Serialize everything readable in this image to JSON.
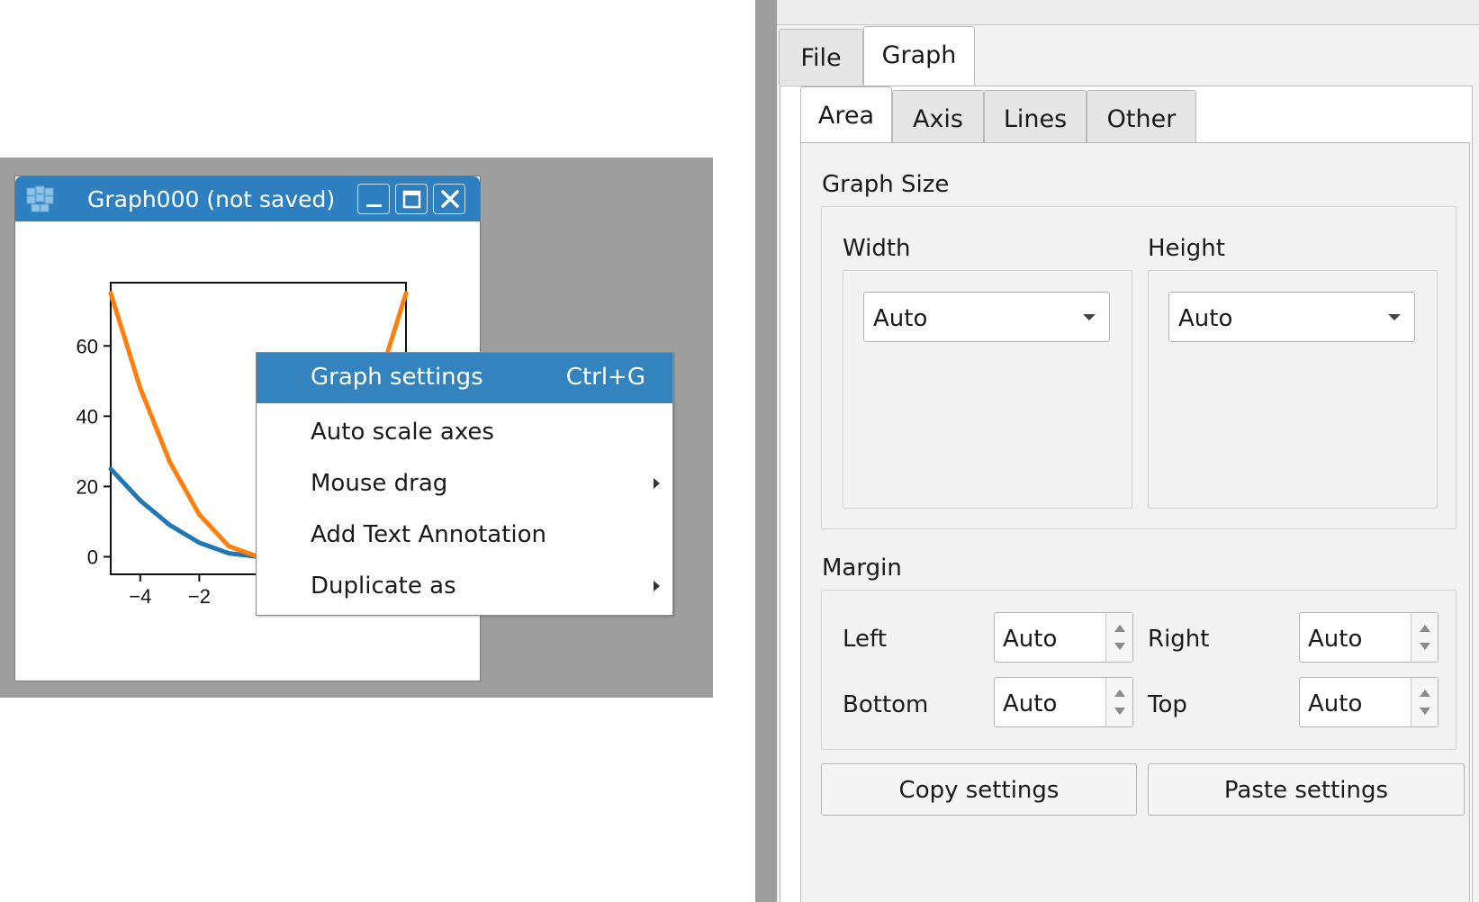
{
  "graph_window": {
    "title": "Graph000 (not saved)",
    "icons": {
      "app": "app-cube-icon",
      "minimize": "minimize-icon",
      "maximize": "maximize-icon",
      "close": "close-icon"
    }
  },
  "chart_data": {
    "type": "line",
    "xlim": [
      -5,
      5
    ],
    "ylim": [
      -5,
      78
    ],
    "xticks": [
      -4,
      -2
    ],
    "yticks": [
      0,
      20,
      40,
      60
    ],
    "grid": false,
    "series": [
      {
        "color": "#1f77b4",
        "x": [
          -5,
          -4,
          -3,
          -2,
          -1,
          0
        ],
        "y": [
          25,
          16,
          9,
          4,
          1,
          0
        ]
      },
      {
        "color": "#ff7f0e",
        "x": [
          -5,
          -4,
          -3,
          -2,
          -1,
          0,
          4,
          5
        ],
        "y": [
          75,
          48,
          27,
          12,
          3,
          0,
          48,
          75
        ]
      }
    ]
  },
  "context_menu": {
    "items": [
      {
        "label": "Graph settings",
        "shortcut": "Ctrl+G",
        "submenu": false
      },
      {
        "label": "Auto scale axes",
        "shortcut": "",
        "submenu": false
      },
      {
        "label": "Mouse drag",
        "shortcut": "",
        "submenu": true
      },
      {
        "label": "Add Text Annotation",
        "shortcut": "",
        "submenu": false
      },
      {
        "label": "Duplicate as",
        "shortcut": "",
        "submenu": true
      }
    ]
  },
  "settings_panel": {
    "tabs": [
      "File",
      "Graph"
    ],
    "active_tab": "Graph",
    "subtabs": [
      "Area",
      "Axis",
      "Lines",
      "Other"
    ],
    "active_subtab": "Area",
    "graph_size": {
      "title": "Graph Size",
      "width_label": "Width",
      "width_value": "Auto",
      "height_label": "Height",
      "height_value": "Auto"
    },
    "margin": {
      "title": "Margin",
      "left_label": "Left",
      "left_value": "Auto",
      "right_label": "Right",
      "right_value": "Auto",
      "bottom_label": "Bottom",
      "bottom_value": "Auto",
      "top_label": "Top",
      "top_value": "Auto"
    },
    "buttons": {
      "copy": "Copy settings",
      "paste": "Paste settings"
    }
  }
}
